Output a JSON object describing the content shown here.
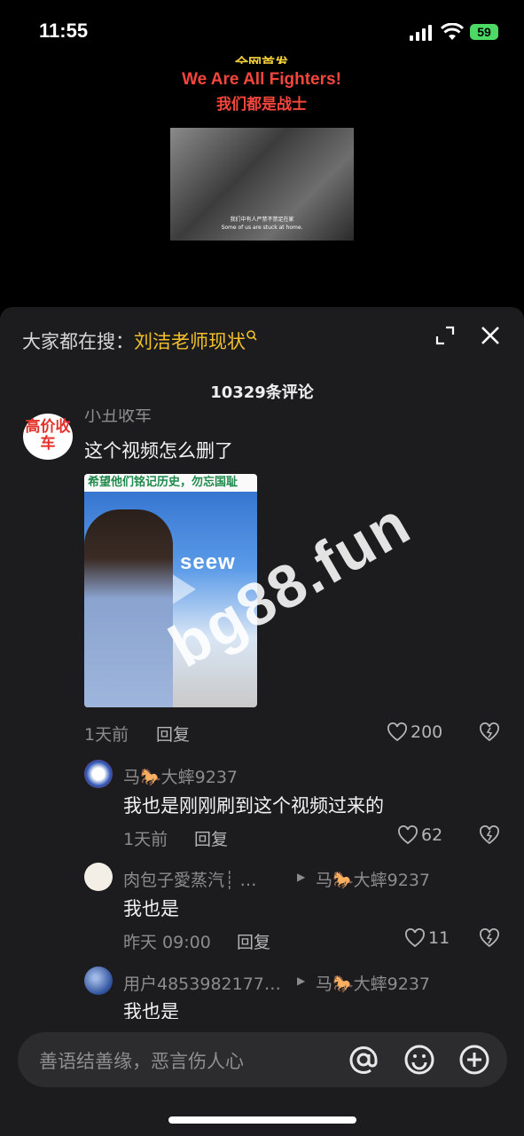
{
  "status": {
    "time": "11:55",
    "battery": "59"
  },
  "video": {
    "caption_top": "全网首发",
    "caption_en": "We Are All Fighters!",
    "caption_cn": "我们都是战士",
    "subtitle_cn": "我们中有人严禁不禁足在家",
    "subtitle_en": "Some of us are stuck at home."
  },
  "header": {
    "search_prefix": "大家都在搜：",
    "search_keyword": "刘洁老师现状",
    "comment_count": "10329条评论"
  },
  "main_comment": {
    "avatar_text": "高价收车",
    "username": "小丑收车",
    "text": "这个视频怎么删了",
    "thumb_banner": "希望他们铭记历史，勿忘国耻",
    "thumb_screen_text": "seew",
    "time": "1天前",
    "reply_label": "回复",
    "likes": "200"
  },
  "replies": [
    {
      "username": "马🐎大蟀9237",
      "text": "我也是刚刚刷到这个视频过来的",
      "time": "1天前",
      "reply_label": "回复",
      "likes": "62"
    },
    {
      "username": "肉包子愛蒸汽┊ …",
      "reply_to": "马🐎大蟀9237",
      "text": "我也是",
      "time": "昨天 09:00",
      "reply_label": "回复",
      "likes": "11"
    },
    {
      "username": "用户4853982177…",
      "reply_to": "马🐎大蟀9237",
      "text": "我也是"
    }
  ],
  "input": {
    "placeholder": "善语结善缘，恶言伤人心"
  },
  "watermark": "bg88.fun",
  "colors": {
    "accent_yellow": "#f5c02a",
    "sheet_bg": "#1c1c1e",
    "battery_green": "#4cd964"
  }
}
